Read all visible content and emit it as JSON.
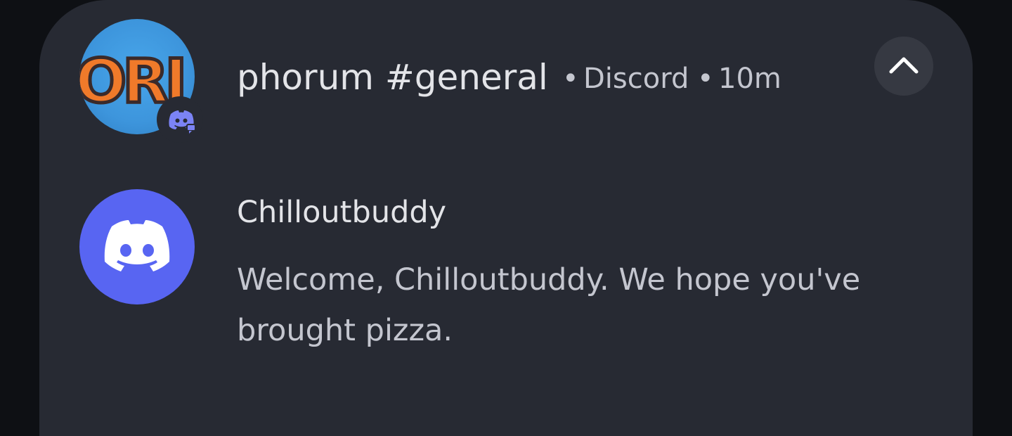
{
  "notification": {
    "server_avatar_text": "ORI",
    "title": "phorum #general",
    "separator": "•",
    "app_name": "Discord",
    "time": "10m",
    "app_badge_icon": "discord-icon",
    "collapse_icon": "chevron-up-icon"
  },
  "message": {
    "avatar_icon": "discord-icon",
    "sender": "Chilloutbuddy",
    "text": "Welcome, Chilloutbuddy. We hope you've brought pizza."
  },
  "colors": {
    "card_background": "#272a33",
    "discord_blurple": "#5865f2",
    "server_avatar_blue": "#3d95dc",
    "server_avatar_orange": "#f07a2a"
  }
}
